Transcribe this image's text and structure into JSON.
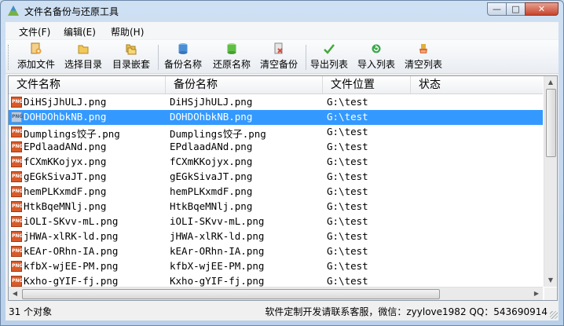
{
  "window": {
    "title": "文件名备份与还原工具"
  },
  "menu": [
    {
      "label": "文件(F)"
    },
    {
      "label": "编辑(E)"
    },
    {
      "label": "帮助(H)"
    }
  ],
  "toolbar": [
    {
      "label": "添加文件",
      "icon": "add-file-icon",
      "color": "#e8a23a"
    },
    {
      "label": "选择目录",
      "icon": "folder-icon",
      "color": "#e0b040"
    },
    {
      "label": "目录嵌套",
      "icon": "nested-folder-icon",
      "color": "#d9a636"
    },
    {
      "label": "备份名称",
      "icon": "backup-db-icon",
      "color": "#4a8fd6"
    },
    {
      "label": "还原名称",
      "icon": "restore-db-icon",
      "color": "#5fbf45"
    },
    {
      "label": "清空备份",
      "icon": "clear-backup-icon",
      "color": "#d74a3a"
    },
    {
      "label": "导出列表",
      "icon": "export-check-icon",
      "color": "#43a83a"
    },
    {
      "label": "导入列表",
      "icon": "import-refresh-icon",
      "color": "#3aa84a"
    },
    {
      "label": "清空列表",
      "icon": "clear-list-icon",
      "color": "#e06a30"
    }
  ],
  "columns": [
    "文件名称",
    "备份名称",
    "文件位置",
    "状态"
  ],
  "rows": [
    {
      "name": "DiHSjJhULJ.png",
      "backup": "DiHSjJhULJ.png",
      "location": "G:\\test",
      "status": ""
    },
    {
      "name": "DOHDOhbkNB.png",
      "backup": "DOHDOhbkNB.png",
      "location": "G:\\test",
      "status": ""
    },
    {
      "name": "Dumplings饺子.png",
      "backup": "Dumplings饺子.png",
      "location": "G:\\test",
      "status": ""
    },
    {
      "name": "EPdlaadANd.png",
      "backup": "EPdlaadANd.png",
      "location": "G:\\test",
      "status": ""
    },
    {
      "name": "fCXmKKojyx.png",
      "backup": "fCXmKKojyx.png",
      "location": "G:\\test",
      "status": ""
    },
    {
      "name": "gEGkSivaJT.png",
      "backup": "gEGkSivaJT.png",
      "location": "G:\\test",
      "status": ""
    },
    {
      "name": "hemPLKxmdF.png",
      "backup": "hemPLKxmdF.png",
      "location": "G:\\test",
      "status": ""
    },
    {
      "name": "HtkBqeMNlj.png",
      "backup": "HtkBqeMNlj.png",
      "location": "G:\\test",
      "status": ""
    },
    {
      "name": "iOLI-SKvv-mL.png",
      "backup": "iOLI-SKvv-mL.png",
      "location": "G:\\test",
      "status": ""
    },
    {
      "name": "jHWA-xlRK-ld.png",
      "backup": "jHWA-xlRK-ld.png",
      "location": "G:\\test",
      "status": ""
    },
    {
      "name": "kEAr-ORhn-IA.png",
      "backup": "kEAr-ORhn-IA.png",
      "location": "G:\\test",
      "status": ""
    },
    {
      "name": "kfbX-wjEE-PM.png",
      "backup": "kfbX-wjEE-PM.png",
      "location": "G:\\test",
      "status": ""
    },
    {
      "name": "Kxho-gYIF-fj.png",
      "backup": "Kxho-gYIF-fj.png",
      "location": "G:\\test",
      "status": ""
    }
  ],
  "selected_row": 1,
  "file_icon_text": "PNG",
  "status": {
    "count": "31 个对象",
    "contact": "软件定制开发请联系客服，微信：zyylove1982  QQ：543690914"
  }
}
